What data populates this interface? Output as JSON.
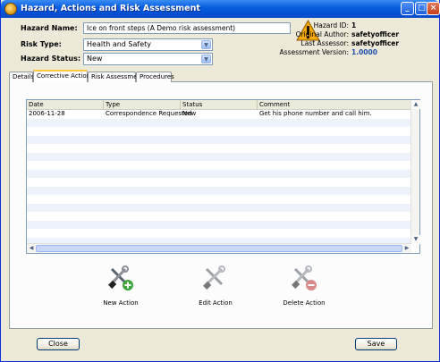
{
  "window": {
    "title": "Hazard, Actions and Risk Assessment"
  },
  "form": {
    "hazard_name_label": "Hazard Name:",
    "hazard_name_value": "Ice on front steps (A Demo risk assessment)",
    "risk_type_label": "Risk Type:",
    "risk_type_value": "Health and Safety",
    "hazard_status_label": "Hazard Status:",
    "hazard_status_value": "New"
  },
  "info": {
    "hazard_id_label": "Hazard ID:",
    "hazard_id_value": "1",
    "original_author_label": "Original Author:",
    "original_author_value": "safetyofficer",
    "last_assessor_label": "Last Assessor:",
    "last_assessor_value": "safetyofficer",
    "assessment_version_label": "Assessment Version:",
    "assessment_version_value": "1.0000",
    "version_color": "#1f4ea8"
  },
  "tabs": [
    {
      "label": "Details"
    },
    {
      "label": "Corrective Actions"
    },
    {
      "label": "Risk Assessment"
    },
    {
      "label": "Procedures"
    }
  ],
  "active_tab": "Corrective Actions",
  "table": {
    "columns": [
      "Date",
      "Type",
      "Status",
      "Comment"
    ],
    "rows": [
      {
        "date": "2006-11-28",
        "type": "Correspondence Requested",
        "status": "New",
        "comment": "Get his phone number and call him."
      }
    ]
  },
  "actions": {
    "new_label": "New Action",
    "edit_label": "Edit Action",
    "delete_label": "Delete Action"
  },
  "buttons": {
    "close_label": "Close",
    "save_label": "Save"
  },
  "icons": {
    "title": "app-icon",
    "warning": "warning-triangle-icon",
    "new": "tools-add-icon",
    "edit": "tools-icon",
    "delete": "tools-delete-icon"
  },
  "colors": {
    "titlebar": "#0a5fe0",
    "window_bg": "#ece9d8",
    "active_tab_accent": "#ffc83c",
    "warning": "#f5a800"
  }
}
